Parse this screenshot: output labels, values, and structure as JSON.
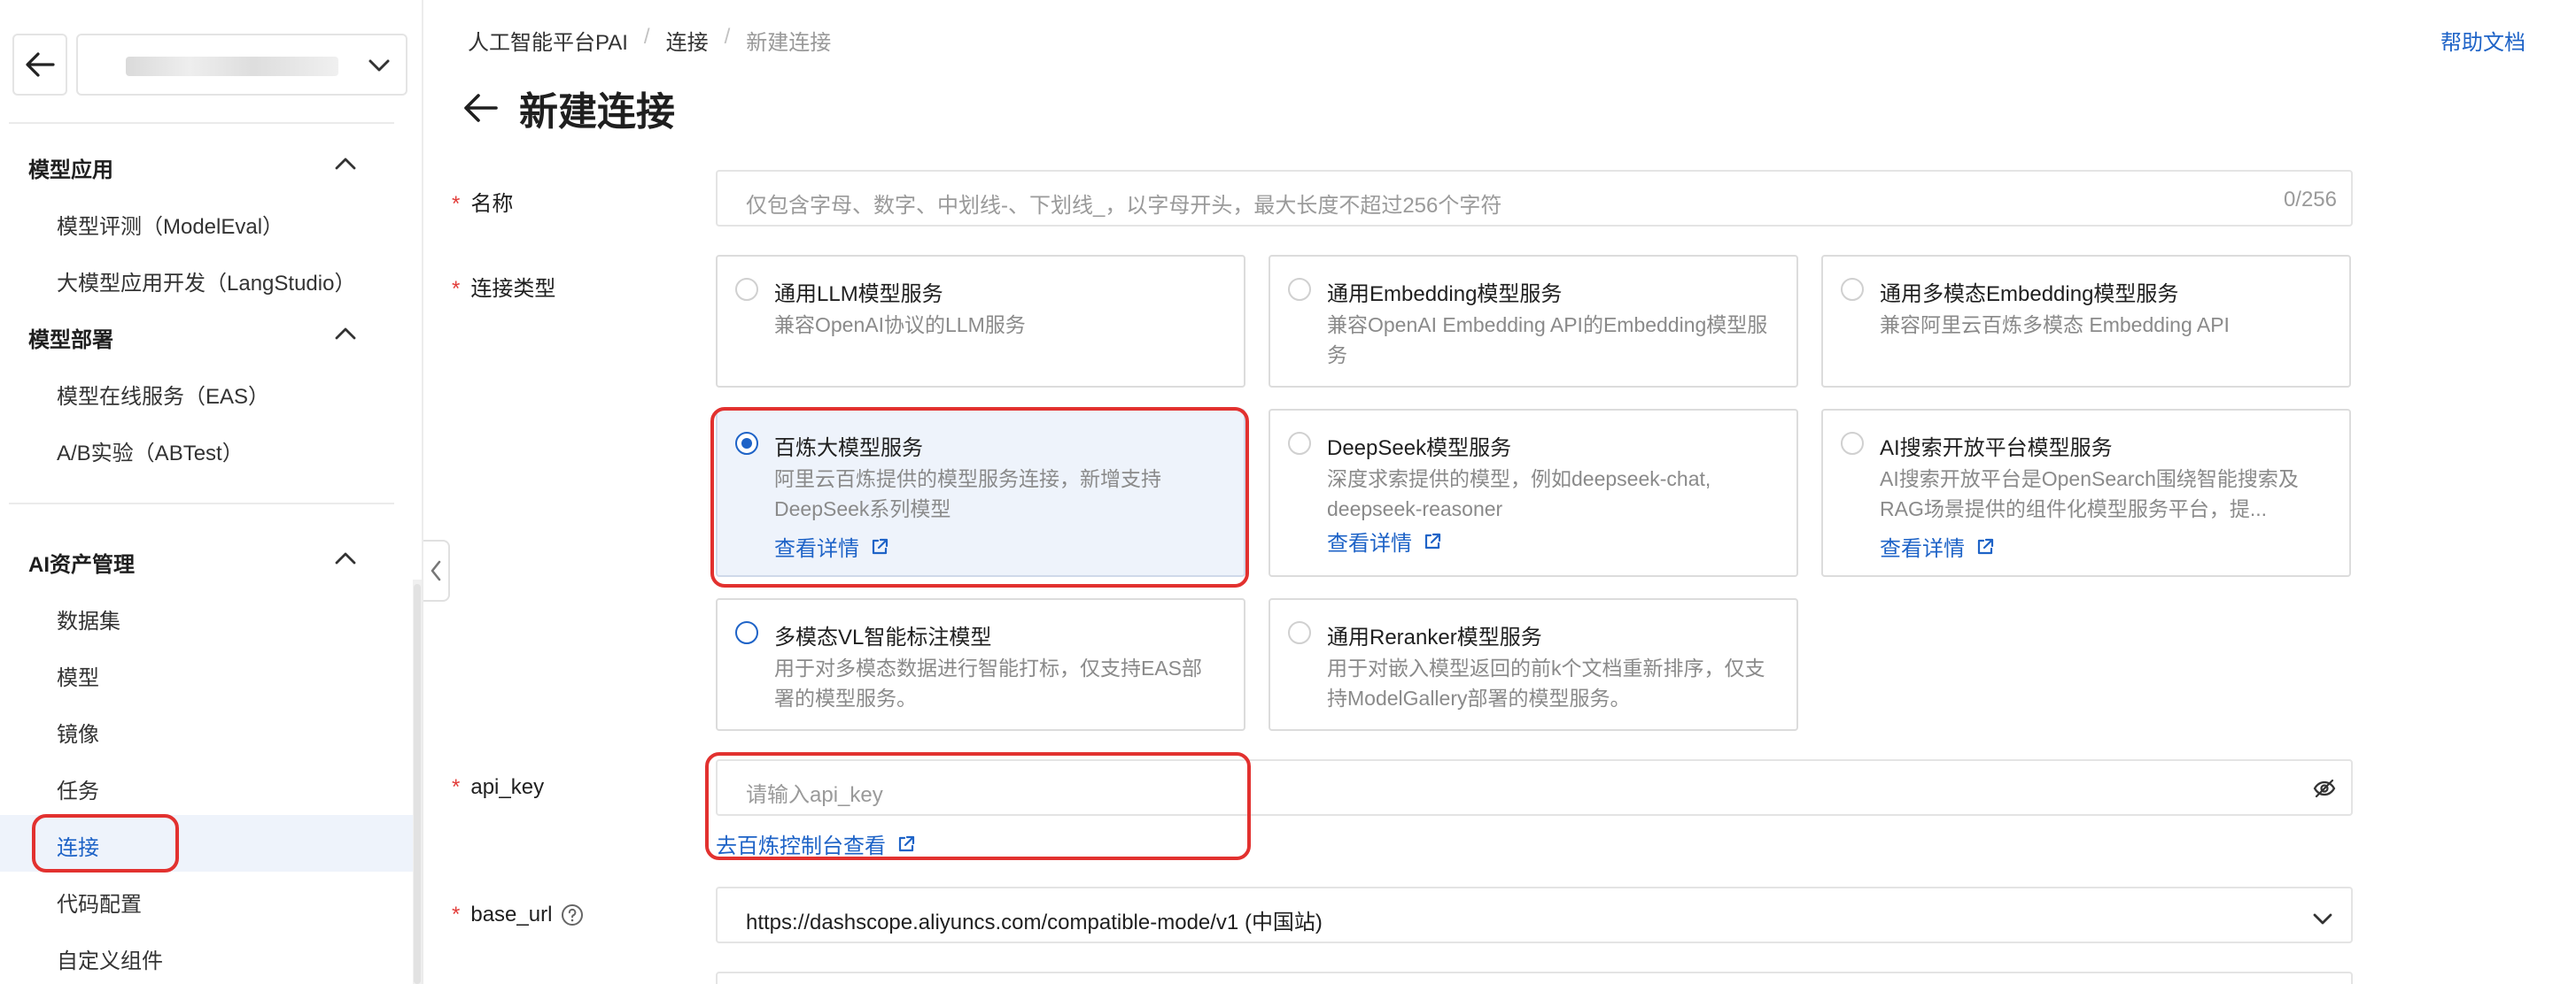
{
  "sidebar": {
    "groups": [
      {
        "title": "模型应用",
        "items": [
          "模型评测（ModelEval）",
          "大模型应用开发（LangStudio）"
        ]
      },
      {
        "title": "模型部署",
        "items": [
          "模型在线服务（EAS）",
          "A/B实验（ABTest）"
        ]
      },
      {
        "title": "AI资产管理",
        "items": [
          "数据集",
          "模型",
          "镜像",
          "任务",
          "连接",
          "代码配置",
          "自定义组件"
        ]
      }
    ],
    "active_item": "连接"
  },
  "breadcrumb": {
    "items": [
      "人工智能平台PAI",
      "连接",
      "新建连接"
    ]
  },
  "help_link": "帮助文档",
  "page_title": "新建连接",
  "form": {
    "name": {
      "label": "名称",
      "placeholder": "仅包含字母、数字、中划线-、下划线_，以字母开头，最大长度不超过256个字符",
      "counter": "0/256"
    },
    "type": {
      "label": "连接类型",
      "cards": [
        {
          "title": "通用LLM模型服务",
          "desc": "兼容OpenAI协议的LLM服务",
          "link": ""
        },
        {
          "title": "通用Embedding模型服务",
          "desc": "兼容OpenAI Embedding API的Embedding模型服务",
          "link": ""
        },
        {
          "title": "通用多模态Embedding模型服务",
          "desc": "兼容阿里云百炼多模态 Embedding API",
          "link": ""
        },
        {
          "title": "百炼大模型服务",
          "desc": "阿里云百炼提供的模型服务连接，新增支持DeepSeek系列模型",
          "link": "查看详情"
        },
        {
          "title": "DeepSeek模型服务",
          "desc": "深度求索提供的模型，例如deepseek-chat, deepseek-reasoner",
          "link": "查看详情"
        },
        {
          "title": "AI搜索开放平台模型服务",
          "desc": "AI搜索开放平台是OpenSearch围绕智能搜索及RAG场景提供的组件化模型服务平台，提...",
          "link": "查看详情"
        },
        {
          "title": "多模态VL智能标注模型",
          "desc": "用于对多模态数据进行智能打标，仅支持EAS部署的模型服务。",
          "link": ""
        },
        {
          "title": "通用Reranker模型服务",
          "desc": "用于对嵌入模型返回的前k个文档重新排序，仅支持ModelGallery部署的模型服务。",
          "link": ""
        }
      ],
      "selected": "百炼大模型服务"
    },
    "api_key": {
      "label": "api_key",
      "placeholder": "请输入api_key",
      "link": "去百炼控制台查看"
    },
    "base_url": {
      "label": "base_url",
      "value": "https://dashscope.aliyuncs.com/compatible-mode/v1 (中国站)"
    }
  },
  "colors": {
    "accent": "#1e63c7",
    "required": "#e23c39",
    "highlight": "#e2312f",
    "selected_bg": "#eef3fb"
  },
  "icons": [
    "arrow-left-icon",
    "chevron-down-icon",
    "chevron-up-icon",
    "chevron-left-icon",
    "external-link-icon",
    "eye-off-icon",
    "help-circle-icon"
  ]
}
